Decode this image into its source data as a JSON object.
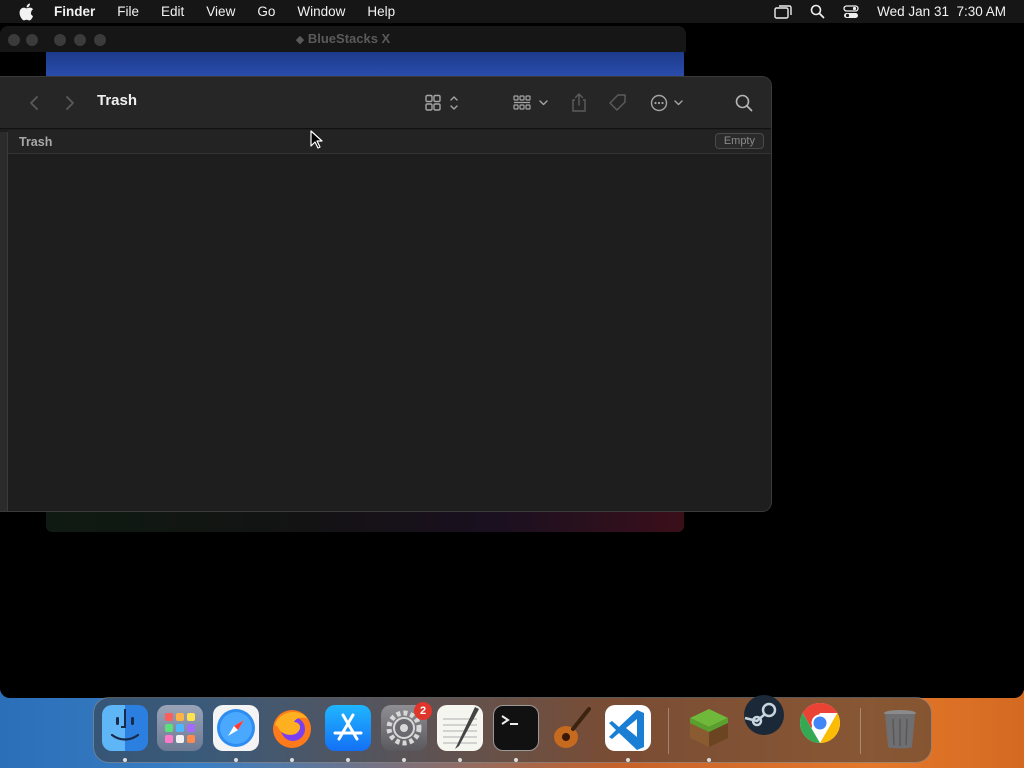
{
  "menubar": {
    "apple": "",
    "app_name": "Finder",
    "items": [
      "File",
      "Edit",
      "View",
      "Go",
      "Window",
      "Help"
    ],
    "clock": "Wed Jan 31  7:30 AM"
  },
  "background_window": {
    "title": "BlueStacks X"
  },
  "finder": {
    "title": "Trash",
    "path_label": "Trash",
    "empty_button": "Empty"
  },
  "dock": {
    "apps": [
      {
        "name": "Finder",
        "icon": "finder-icon",
        "running": true
      },
      {
        "name": "Launchpad",
        "icon": "launchpad-icon",
        "running": false
      },
      {
        "name": "Safari",
        "icon": "safari-icon",
        "running": true
      },
      {
        "name": "Firefox",
        "icon": "firefox-icon",
        "running": true
      },
      {
        "name": "App Store",
        "icon": "app-store-icon",
        "running": true
      },
      {
        "name": "System Settings",
        "icon": "system-settings-icon",
        "running": true,
        "badge": "2"
      },
      {
        "name": "TextEdit",
        "icon": "textedit-icon",
        "running": true
      },
      {
        "name": "Terminal",
        "icon": "terminal-icon",
        "running": true
      },
      {
        "name": "GarageBand",
        "icon": "garageband-icon",
        "running": false
      },
      {
        "name": "Visual Studio Code",
        "icon": "vscode-icon",
        "running": true
      },
      {
        "name": "Minecraft",
        "icon": "minecraft-icon",
        "running": true
      },
      {
        "name": "Steam",
        "icon": "steam-icon",
        "running": false
      },
      {
        "name": "Google Chrome",
        "icon": "chrome-icon",
        "running": false
      },
      {
        "name": "Trash",
        "icon": "trash-icon",
        "running": false
      }
    ]
  }
}
